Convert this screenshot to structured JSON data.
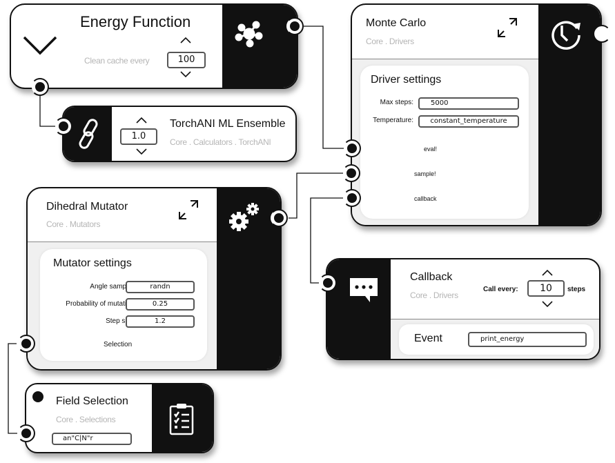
{
  "energy_function": {
    "title": "Energy Function",
    "clean_cache_label": "Clean cache every",
    "clean_cache_value": "100",
    "collapse_icon": "chevron-down-icon",
    "icon": "molecule-icon"
  },
  "torchani": {
    "title": "TorchANI ML Ensemble",
    "breadcrumb": "Core . Calculators . TorchANI",
    "value": "1.0",
    "icon": "link-icon"
  },
  "monte_carlo": {
    "title": "Monte Carlo",
    "breadcrumb": "Core . Drivers",
    "settings_title": "Driver settings",
    "fields": [
      {
        "label": "Max steps:",
        "value": "5000"
      },
      {
        "label": "Temperature:",
        "value": "constant_temperature"
      }
    ],
    "ports": [
      "eval!",
      "sample!",
      "callback"
    ],
    "icon": "clock-refresh-icon"
  },
  "dihedral_mutator": {
    "title": "Dihedral Mutator",
    "breadcrumb": "Core . Mutators",
    "settings_title": "Mutator settings",
    "fields": [
      {
        "label": "Angle sampler:",
        "value": "randn"
      },
      {
        "label": "Probability of mutation:",
        "value": "0.25"
      },
      {
        "label": "Step size:",
        "value": "1.2"
      }
    ],
    "port": "Selection",
    "icon": "gears-icon"
  },
  "field_selection": {
    "title": "Field Selection",
    "breadcrumb": "Core . Selections",
    "value": "an\"C|N\"r",
    "icon": "clipboard-checklist-icon"
  },
  "callback": {
    "title": "Callback",
    "breadcrumb": "Core . Drivers",
    "call_every_label": "Call every:",
    "call_every_value": "10",
    "steps_label": "steps",
    "event_label": "Event",
    "event_value": "print_energy",
    "icon": "chat-bubble-icon"
  }
}
